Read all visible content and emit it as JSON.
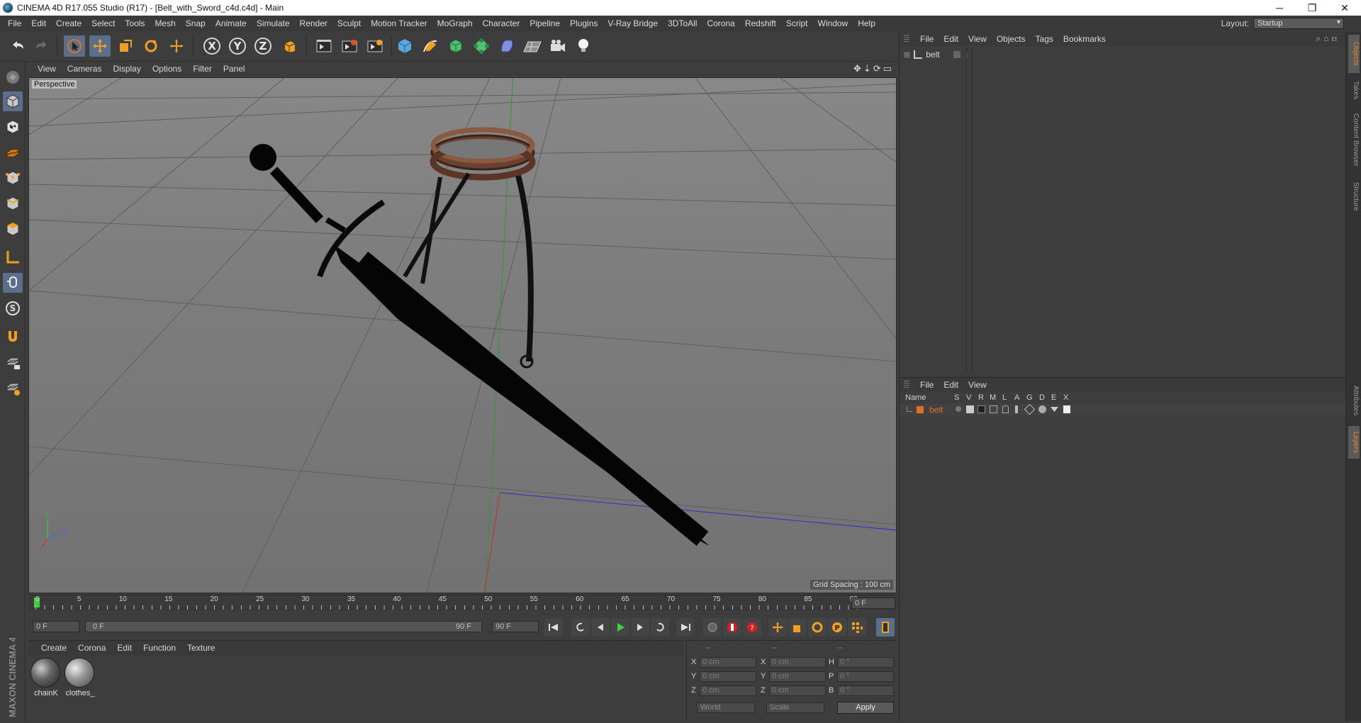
{
  "window": {
    "title": "CINEMA 4D R17.055 Studio (R17) - [Belt_with_Sword_c4d.c4d] - Main",
    "controls": [
      "─",
      "❐",
      "✕"
    ]
  },
  "menubar": {
    "items": [
      "File",
      "Edit",
      "Create",
      "Select",
      "Tools",
      "Mesh",
      "Snap",
      "Animate",
      "Simulate",
      "Render",
      "Sculpt",
      "Motion Tracker",
      "MoGraph",
      "Character",
      "Pipeline",
      "Plugins",
      "V-Ray Bridge",
      "3DToAll",
      "Corona",
      "Redshift",
      "Script",
      "Window",
      "Help"
    ],
    "layout_label": "Layout:",
    "layout_value": "Startup"
  },
  "toolbar": {
    "axis_x": "X",
    "axis_y": "Y",
    "axis_z": "Z",
    "icons": [
      "undo-icon",
      "redo-icon",
      "select-arrow-icon",
      "move-icon",
      "scale-icon",
      "rotate-icon",
      "live-move-icon",
      "axis-x-icon",
      "axis-y-icon",
      "axis-z-icon",
      "coordinate-system-icon",
      "render-view-icon",
      "render-picture-viewer-icon",
      "render-settings-icon",
      "cube-primitive-icon",
      "spline-pen-icon",
      "subdivision-icon",
      "mograph-cloner-icon",
      "deformer-icon",
      "floor-environment-icon",
      "camera-icon",
      "light-icon"
    ]
  },
  "viewport": {
    "menu": [
      "View",
      "Cameras",
      "Display",
      "Options",
      "Filter",
      "Panel"
    ],
    "label": "Perspective",
    "grid_spacing": "Grid Spacing : 100 cm",
    "axis_y": "Y",
    "axis_z": "Z"
  },
  "timeline": {
    "ticks": [
      "0",
      "5",
      "10",
      "15",
      "20",
      "25",
      "30",
      "35",
      "40",
      "45",
      "50",
      "55",
      "60",
      "65",
      "70",
      "75",
      "80",
      "85",
      "90"
    ],
    "current_frame": "0 F",
    "start_field": "0 F",
    "range_start": "0 F",
    "range_end": "90 F",
    "end_field": "90 F"
  },
  "material_manager": {
    "menu": [
      "Create",
      "Corona",
      "Edit",
      "Function",
      "Texture"
    ],
    "materials": [
      {
        "name": "chainK"
      },
      {
        "name": "clothes_"
      }
    ]
  },
  "coordinates": {
    "header": [
      "--",
      "--",
      "--"
    ],
    "rows": [
      {
        "a": "X",
        "av": "0 cm",
        "b": "X",
        "bv": "0 cm",
        "c": "H",
        "cv": "0 °"
      },
      {
        "a": "Y",
        "av": "0 cm",
        "b": "Y",
        "bv": "0 cm",
        "c": "P",
        "cv": "0 °"
      },
      {
        "a": "Z",
        "av": "0 cm",
        "b": "Z",
        "bv": "0 cm",
        "c": "B",
        "cv": "0 °"
      }
    ],
    "space": "World",
    "mode": "Scale",
    "apply": "Apply"
  },
  "object_manager": {
    "menu": [
      "File",
      "Edit",
      "View",
      "Objects",
      "Tags",
      "Bookmarks"
    ],
    "objects": [
      {
        "name": "belt"
      }
    ]
  },
  "layer_manager": {
    "menu": [
      "File",
      "Edit",
      "View"
    ],
    "columns": [
      "Name",
      "S",
      "V",
      "R",
      "M",
      "L",
      "A",
      "G",
      "D",
      "E",
      "X"
    ],
    "layers": [
      {
        "name": "belt",
        "color": "#e07020"
      }
    ]
  },
  "right_tabs": [
    "Objects",
    "Takes",
    "Content Browser",
    "Structure",
    "Attributes",
    "Layers"
  ],
  "brand": "MAXON CINEMA 4D",
  "colors": {
    "accent": "#5b6f8c",
    "layer_orange": "#e07020",
    "play_green": "#3fcf3f"
  }
}
